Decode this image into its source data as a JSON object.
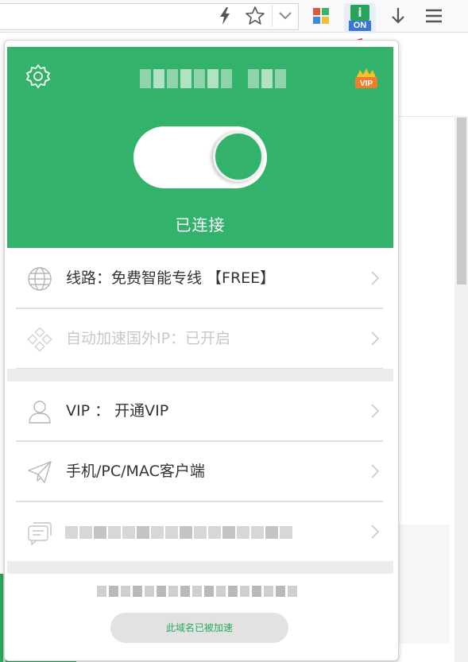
{
  "toolbar": {
    "icons": [
      "lightning-icon",
      "star-icon",
      "chevron-down-icon",
      "extension-grid-icon",
      "extension-on-icon",
      "download-icon",
      "menu-icon"
    ],
    "extension_i_label": "i",
    "extension_on_label": "ON",
    "extension_grid_colors": [
      "#e05a3a",
      "#3bb36a",
      "#3a8be0",
      "#f3c033"
    ]
  },
  "popup": {
    "header_color": "#33b26b",
    "status": "已连接",
    "vip_badge": "VIP",
    "connection_toggle_on": true
  },
  "menu": [
    {
      "id": "route",
      "label": "线路：免费智能专线 【FREE】",
      "icon": "globe-icon"
    },
    {
      "id": "auto",
      "label": "自动加速国外IP：已开启",
      "icon": "diamond-nodes-icon",
      "faded": true
    },
    {
      "id": "vip",
      "label": "VIP ： 开通VIP",
      "icon": "user-icon"
    },
    {
      "id": "clients",
      "label": "手机/PC/MAC客户端",
      "icon": "paper-plane-icon"
    },
    {
      "id": "message",
      "label": "",
      "icon": "message-icon",
      "blurred": true
    }
  ],
  "footer": {
    "button_label": "此域名已被加速"
  }
}
